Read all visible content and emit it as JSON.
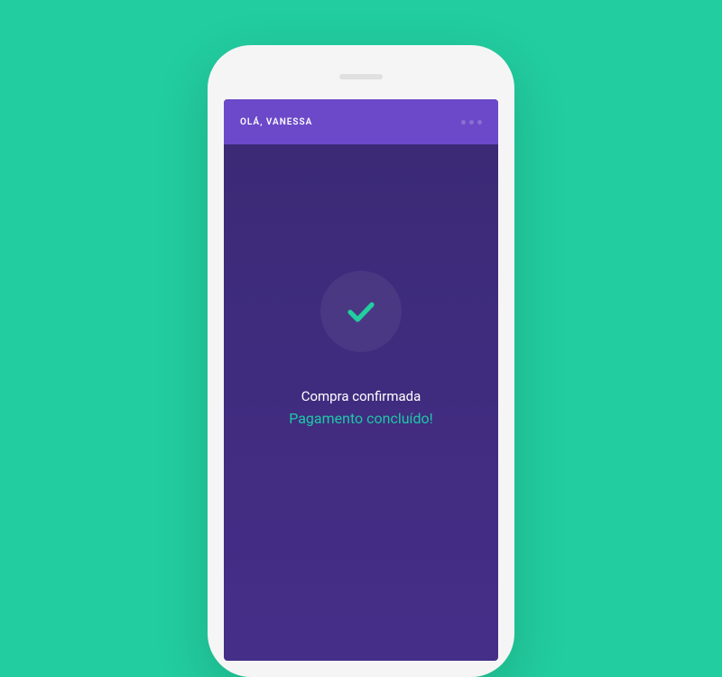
{
  "header": {
    "greeting": "OLÁ, VANESSA"
  },
  "confirmation": {
    "title": "Compra confirmada",
    "subtitle": "Pagamento concluído!"
  }
}
